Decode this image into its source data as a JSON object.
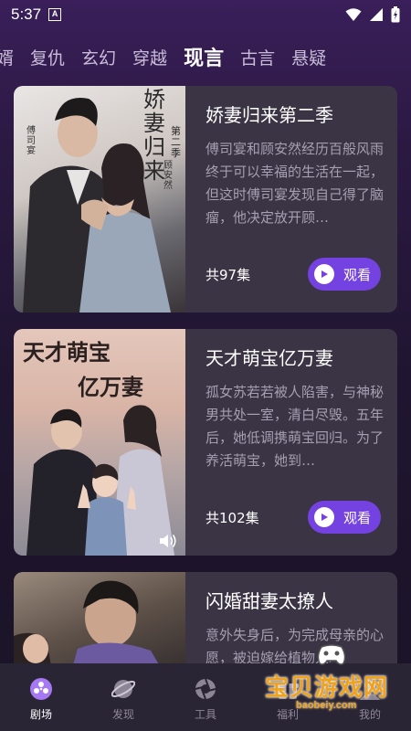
{
  "status": {
    "time": "5:37",
    "notification_badge": "A"
  },
  "tabs": [
    {
      "label": "婿",
      "active": false
    },
    {
      "label": "复仇",
      "active": false
    },
    {
      "label": "玄幻",
      "active": false
    },
    {
      "label": "穿越",
      "active": false
    },
    {
      "label": "现言",
      "active": true
    },
    {
      "label": "古言",
      "active": false
    },
    {
      "label": "悬疑",
      "active": false
    }
  ],
  "cards": [
    {
      "title": "娇妻归来第二季",
      "description": "傅司宴和顾安然经历百般风雨终于可以幸福的生活在一起，但这时傅司宴发现自己得了脑瘤，他决定放开顾…",
      "episodes": "共97集",
      "watch_label": "观看",
      "poster_title": "娇妻归来",
      "poster_subtitle": "第二季",
      "poster_name_left": "傅司宴",
      "poster_name_right": "顾安然"
    },
    {
      "title": "天才萌宝亿万妻",
      "description": "孤女苏若若被人陷害，与神秘男共处一室，清白尽毁。五年后，她低调携萌宝回归。为了养活萌宝，她到…",
      "episodes": "共102集",
      "watch_label": "观看",
      "poster_title_line1": "天才萌宝",
      "poster_title_line2": "亿万妻"
    },
    {
      "title": "闪婚甜妻太撩人",
      "description": "意外失身后，为完成母亲的心愿，被迫嫁给植物人冲"
    }
  ],
  "nav": [
    {
      "label": "剧场",
      "icon": "theater-icon",
      "active": true
    },
    {
      "label": "发现",
      "icon": "planet-icon",
      "active": false
    },
    {
      "label": "工具",
      "icon": "aperture-icon",
      "active": false
    },
    {
      "label": "福利",
      "icon": "gift-icon",
      "active": false
    },
    {
      "label": "我的",
      "icon": "profile-icon",
      "active": false
    }
  ],
  "watermark": {
    "text": "宝贝游戏网",
    "url": "baobeiy.com"
  },
  "colors": {
    "accent": "#7442e0",
    "tab_indicator": "#9b6cf0",
    "card_bg": "#3a3444",
    "nav_bg": "#2a2534"
  }
}
